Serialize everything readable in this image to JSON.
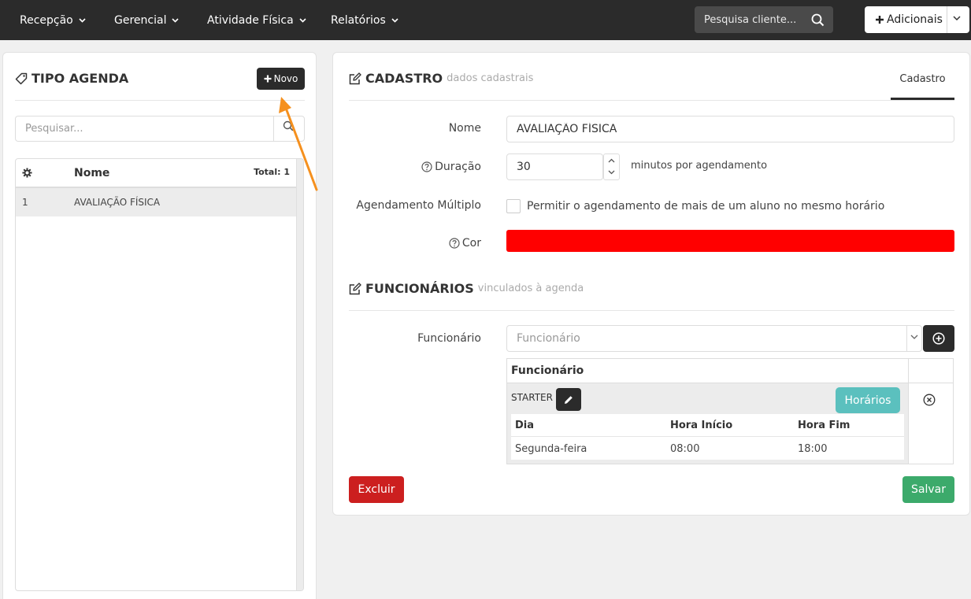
{
  "nav": {
    "items": [
      {
        "label": "Recepção"
      },
      {
        "label": "Gerencial"
      },
      {
        "label": "Atividade Física"
      },
      {
        "label": "Relatórios"
      }
    ],
    "search_placeholder": "Pesquisa cliente...",
    "add_label": "Adicionais"
  },
  "left": {
    "title": "TIPO AGENDA",
    "new_label": "Novo",
    "search_placeholder": "Pesquisar...",
    "table": {
      "col_name": "Nome",
      "total": "Total: 1",
      "rows": [
        {
          "id": "1",
          "name": "AVALIAÇÃO FÍSICA"
        }
      ]
    }
  },
  "right": {
    "title": "CADASTRO",
    "subtitle": "dados cadastrais",
    "tab": "Cadastro",
    "fields": {
      "nome_label": "Nome",
      "nome_value": "AVALIAÇÃO FÍSICA",
      "duracao_label": "Duração",
      "duracao_value": "30",
      "duracao_suffix": "minutos por agendamento",
      "multiplo_label": "Agendamento Múltiplo",
      "multiplo_text": "Permitir o agendamento de mais de um aluno no mesmo horário",
      "cor_label": "Cor",
      "cor_value": "#ff0000"
    },
    "funcionarios": {
      "title": "FUNCIONÁRIOS",
      "subtitle": "vinculados à agenda",
      "label": "Funcionário",
      "select_placeholder": "Funcionário",
      "table_header": "Funcionário",
      "employee": "STARTER",
      "horarios_label": "Horários",
      "schedule_headers": [
        "Dia",
        "Hora Início",
        "Hora Fim"
      ],
      "schedule_rows": [
        {
          "dia": "Segunda-feira",
          "inicio": "08:00",
          "fim": "18:00"
        }
      ]
    },
    "delete_label": "Excluir",
    "save_label": "Salvar"
  },
  "colors": {
    "navbar": "#2b2b2b",
    "danger": "#cc1f1f",
    "success": "#3caa6b",
    "info": "#5bc0be",
    "annotation": "#f5901e"
  }
}
